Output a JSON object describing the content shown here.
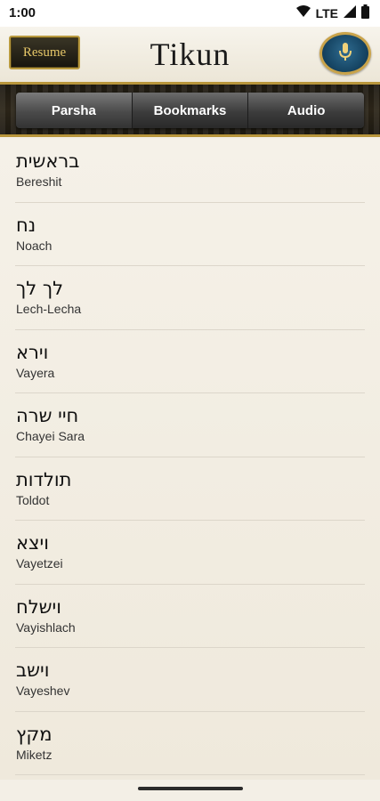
{
  "status_bar": {
    "time": "1:00",
    "network": "LTE"
  },
  "header": {
    "resume_label": "Resume",
    "title": "Tikun",
    "mic_icon": "microphone-icon"
  },
  "tabs": [
    {
      "label": "Parsha"
    },
    {
      "label": "Bookmarks"
    },
    {
      "label": "Audio"
    }
  ],
  "parshiot": [
    {
      "hebrew": "בראשית",
      "english": "Bereshit"
    },
    {
      "hebrew": "נח",
      "english": "Noach"
    },
    {
      "hebrew": "לך לך",
      "english": "Lech-Lecha"
    },
    {
      "hebrew": "וירא",
      "english": "Vayera"
    },
    {
      "hebrew": "חיי שרה",
      "english": "Chayei Sara"
    },
    {
      "hebrew": "תולדות",
      "english": "Toldot"
    },
    {
      "hebrew": "ויצא",
      "english": "Vayetzei"
    },
    {
      "hebrew": "וישלח",
      "english": "Vayishlach"
    },
    {
      "hebrew": "וישב",
      "english": "Vayeshev"
    },
    {
      "hebrew": "מקץ",
      "english": "Miketz"
    }
  ],
  "colors": {
    "gold": "#b8963c",
    "mic_blue": "#174766",
    "parchment": "#f3efe6"
  }
}
